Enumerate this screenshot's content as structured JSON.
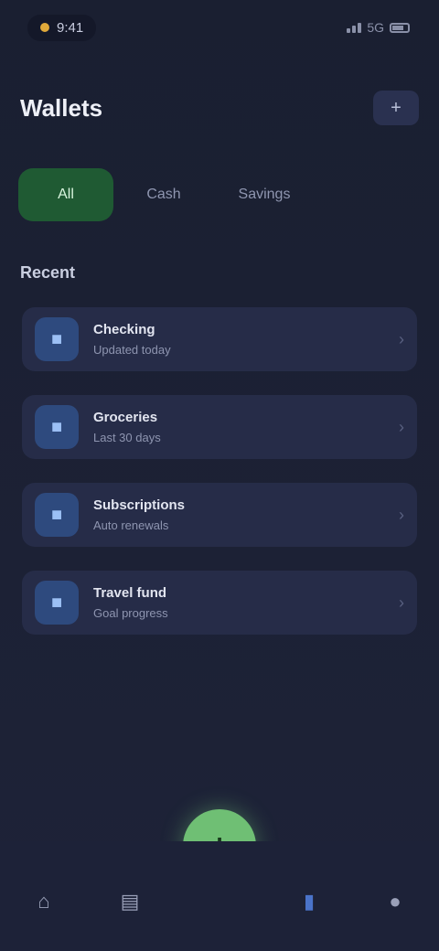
{
  "status_bar": {
    "time": "9:41",
    "network": "5G"
  },
  "header": {
    "title": "Wallets",
    "action_icon": "plus-icon"
  },
  "tabs": [
    {
      "label": "All",
      "active": true
    },
    {
      "label": "Cash",
      "active": false
    },
    {
      "label": "Savings",
      "active": false
    }
  ],
  "section": {
    "label": "Recent"
  },
  "list": {
    "items": [
      {
        "title": "Checking",
        "subtitle": "Updated today",
        "icon": "bank-icon"
      },
      {
        "title": "Groceries",
        "subtitle": "Last 30 days",
        "icon": "cart-icon"
      },
      {
        "title": "Subscriptions",
        "subtitle": "Auto renewals",
        "icon": "repeat-icon"
      },
      {
        "title": "Travel fund",
        "subtitle": "Goal progress",
        "icon": "plane-icon"
      }
    ]
  },
  "bottom_nav": {
    "items": [
      {
        "icon": "home-icon"
      },
      {
        "icon": "chart-icon"
      },
      {
        "icon": "card-icon"
      },
      {
        "icon": "user-icon"
      }
    ],
    "fab_icon": "add-icon"
  },
  "colors": {
    "background": "#1b2033",
    "accent_green": "#6fbf74",
    "active_tab": "#1f5a33",
    "item_icon_bg": "#2e4a7e",
    "nav_active": "#4a73c9"
  }
}
